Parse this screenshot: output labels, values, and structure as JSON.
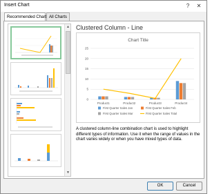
{
  "window": {
    "title": "Insert Chart",
    "help_label": "?",
    "close_label": "✕"
  },
  "tabs": [
    {
      "label": "Recommended Charts",
      "selected": true
    },
    {
      "label": "All Charts",
      "selected": false
    }
  ],
  "thumbnails": [
    "Clustered Column - Line",
    "Clustered Column",
    "Clustered Bar",
    "Stacked Column"
  ],
  "preview": {
    "type_name": "Clustered Column - Line",
    "description": "A clustered column-line combination chart is used to highlight different types of information. Use it when the range of values in the chart varies widely or when you have mixed types of data."
  },
  "buttons": {
    "ok": "OK",
    "cancel": "Cancel"
  },
  "colors": {
    "blue": "#5b9bd5",
    "orange": "#ed7d31",
    "gray": "#a5a5a5",
    "yellow": "#ffc000",
    "selected_border": "#86c89a"
  },
  "chart_data": {
    "type": "bar",
    "title": "Chart Title",
    "categories": [
      "Product1",
      "Product2",
      "Product3",
      "Product4"
    ],
    "ylim": [
      0,
      25
    ],
    "yticks": [
      0,
      5,
      10,
      15,
      20,
      25
    ],
    "series": [
      {
        "name": "First Quarter Sales Jan",
        "kind": "column",
        "color": "#5b9bd5",
        "values": [
          1.5,
          1.2,
          0.8,
          9
        ]
      },
      {
        "name": "First Quarter Sales Feb",
        "kind": "column",
        "color": "#ed7d31",
        "values": [
          1.5,
          1.2,
          0.8,
          8
        ]
      },
      {
        "name": "First Quarter Sales Mar",
        "kind": "column",
        "color": "#a5a5a5",
        "values": [
          1.5,
          1.2,
          0.8,
          8
        ]
      },
      {
        "name": "First Quarter Sales Total",
        "kind": "line",
        "color": "#ffc000",
        "values": [
          5,
          3,
          0.5,
          20
        ]
      }
    ],
    "legend_position": "bottom",
    "grid": true
  }
}
